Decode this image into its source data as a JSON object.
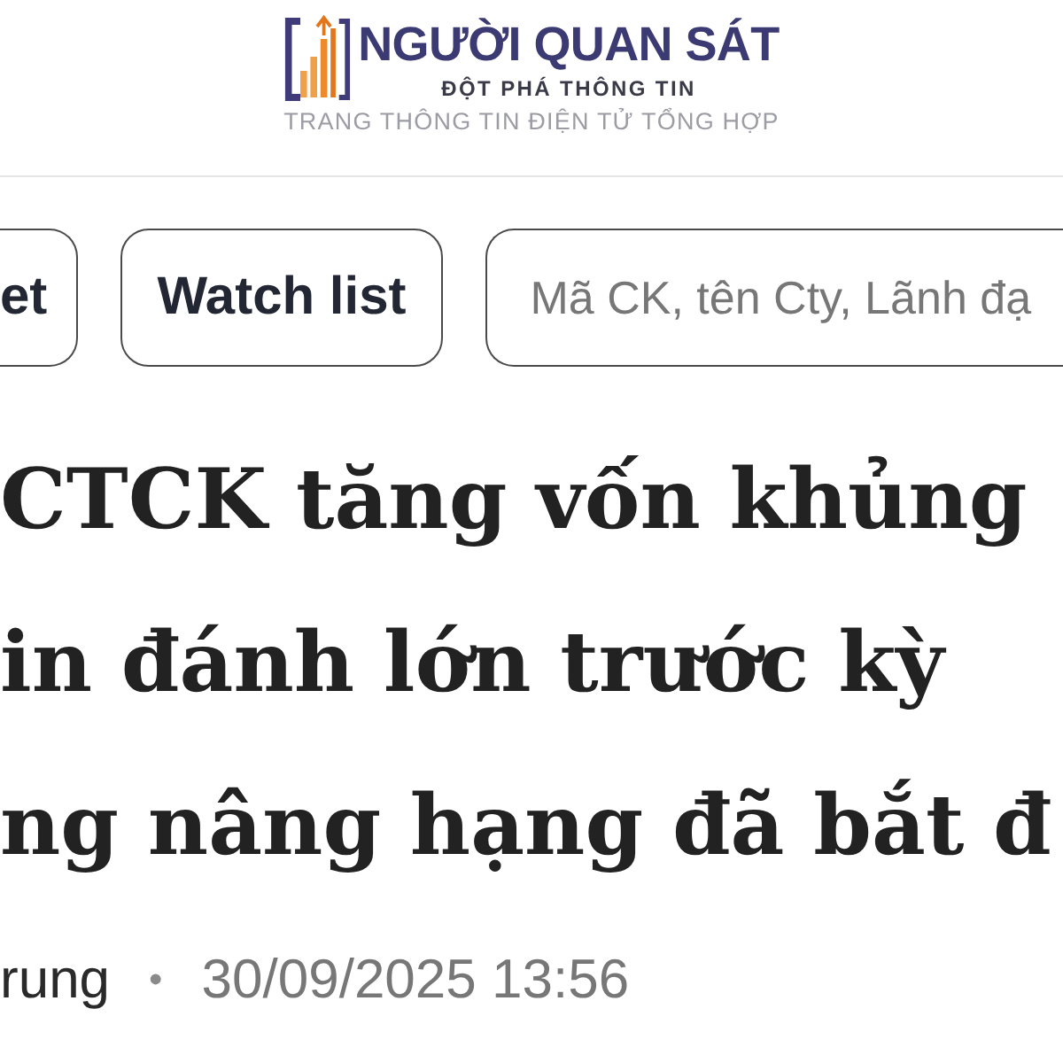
{
  "logo": {
    "name": "NGƯỜI QUAN SÁT",
    "slogan": "ĐỘT PHÁ THÔNG TIN",
    "tagline": "TRANG THÔNG TIN ĐIỆN TỬ TỔNG HỢP"
  },
  "nav": {
    "buttons": [
      {
        "label": "et"
      },
      {
        "label": "Watch list"
      }
    ],
    "search": {
      "placeholder": "Mã CK, tên Cty, Lãnh đạ"
    }
  },
  "article": {
    "headline_lines": [
      "CTCK tăng vốn khủng",
      "in đánh lớn trước kỳ",
      "ng nâng hạng đã bắt đ"
    ],
    "author": "rung",
    "separator": "•",
    "published": "30/09/2025 13:56"
  }
}
